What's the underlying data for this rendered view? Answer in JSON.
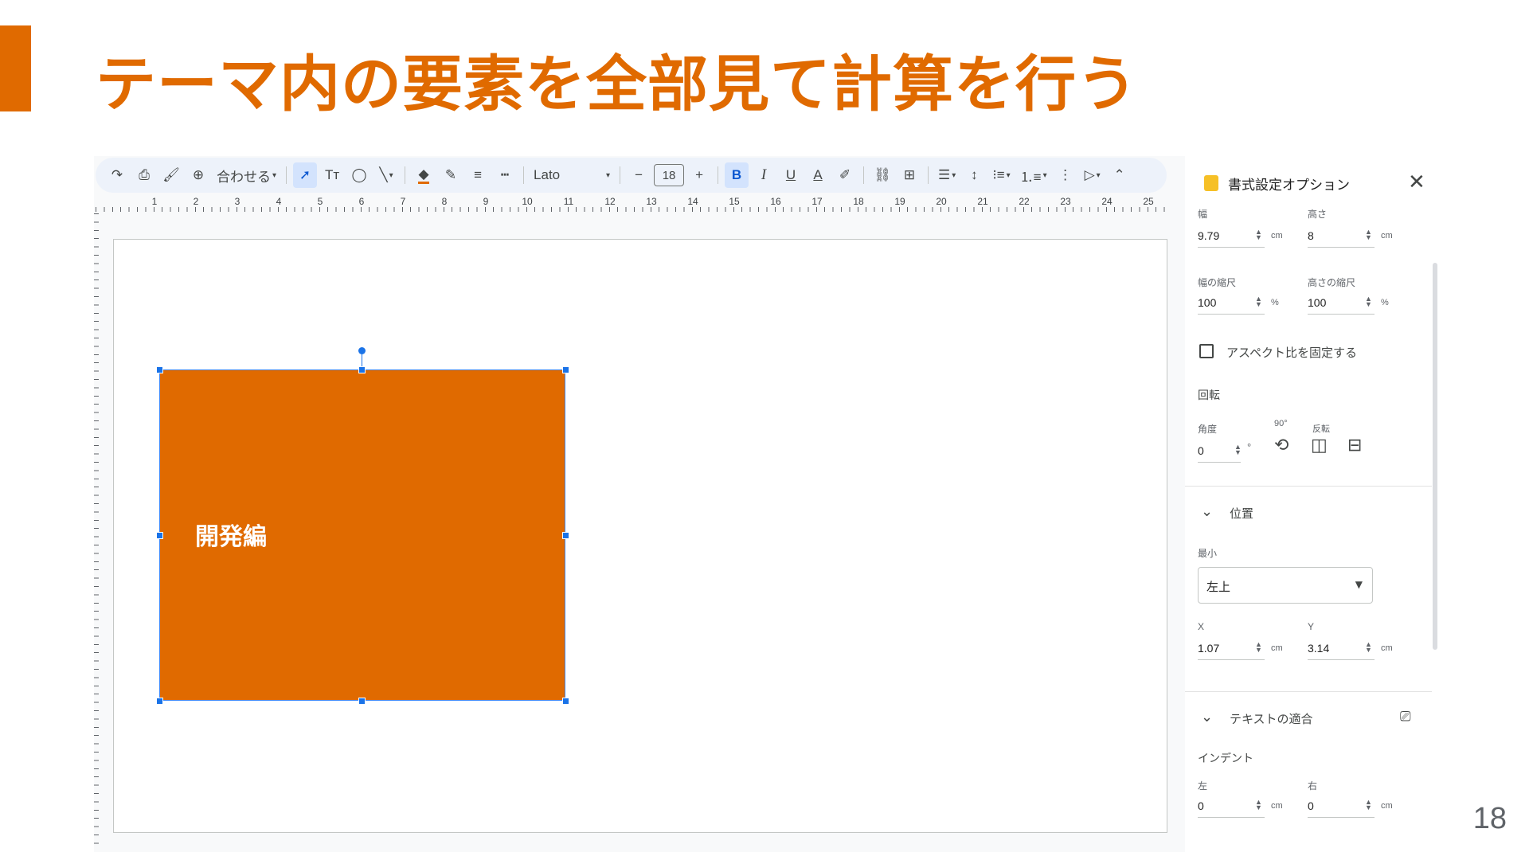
{
  "colors": {
    "accent": "#e06a00",
    "selection": "#1a73e8",
    "toolbar_bg": "#edf2fa"
  },
  "slide": {
    "title": "テーマ内の要素を全部見て計算を行う",
    "page_number": "18"
  },
  "toolbar": {
    "redo_icon": "redo-icon",
    "print_icon": "print-icon",
    "paint_format_icon": "paint-format-icon",
    "zoom_icon": "zoom-icon",
    "zoom_label": "合わせる",
    "select_icon": "cursor-icon",
    "textbox_label": "Tт",
    "shape_icon": "shapes-icon",
    "line_icon": "line-icon",
    "fill_icon": "fill-color-icon",
    "border_color_icon": "pencil-icon",
    "border_weight_icon": "border-weight-icon",
    "border_dash_icon": "border-dash-icon",
    "font_name": "Lato",
    "decrease_label": "−",
    "font_size": "18",
    "increase_label": "+",
    "bold_label": "B",
    "italic_label": "I",
    "underline_label": "U",
    "text_color_label": "A",
    "highlight_icon": "highlighter-icon",
    "link_icon": "link-icon",
    "comment_icon": "add-comment-icon",
    "align_icon": "align-left-icon",
    "line_spacing_icon": "line-spacing-icon",
    "bullets_icon": "bulleted-list-icon",
    "numbered_icon": "numbered-list-icon",
    "more_icon": "more-vert-icon",
    "pen_icon": "pen-icon",
    "collapse_icon": "chevron-up-icon"
  },
  "ruler": {
    "marks": [
      "1",
      "2",
      "3",
      "4",
      "5",
      "6",
      "7",
      "8",
      "9",
      "10",
      "11",
      "12",
      "13",
      "14",
      "15",
      "16",
      "17",
      "18",
      "19",
      "20",
      "21",
      "22",
      "23",
      "24",
      "25"
    ]
  },
  "canvas": {
    "shape_text": "開発編"
  },
  "panel": {
    "title": "書式設定オプション",
    "size": {
      "width_label": "幅",
      "width_value": "9.79",
      "width_unit": "cm",
      "height_label": "高さ",
      "height_value": "8",
      "height_unit": "cm",
      "width_scale_label": "幅の縮尺",
      "width_scale_value": "100",
      "width_scale_unit": "%",
      "height_scale_label": "高さの縮尺",
      "height_scale_value": "100",
      "height_scale_unit": "%",
      "lock_aspect_label": "アスペクト比を固定する",
      "lock_aspect_checked": false
    },
    "rotation": {
      "heading": "回転",
      "angle_label": "角度",
      "angle_value": "0",
      "angle_unit": "°",
      "rotate90_label": "90°",
      "flip_label": "反転"
    },
    "position": {
      "heading": "位置",
      "origin_label": "最小",
      "origin_value": "左上",
      "x_label": "X",
      "x_value": "1.07",
      "x_unit": "cm",
      "y_label": "Y",
      "y_value": "3.14",
      "y_unit": "cm"
    },
    "text_fit": {
      "heading": "テキストの適合",
      "indent_label": "インデント",
      "left_label": "左",
      "left_value": "0",
      "left_unit": "cm",
      "right_label": "右",
      "right_value": "0",
      "right_unit": "cm"
    }
  }
}
